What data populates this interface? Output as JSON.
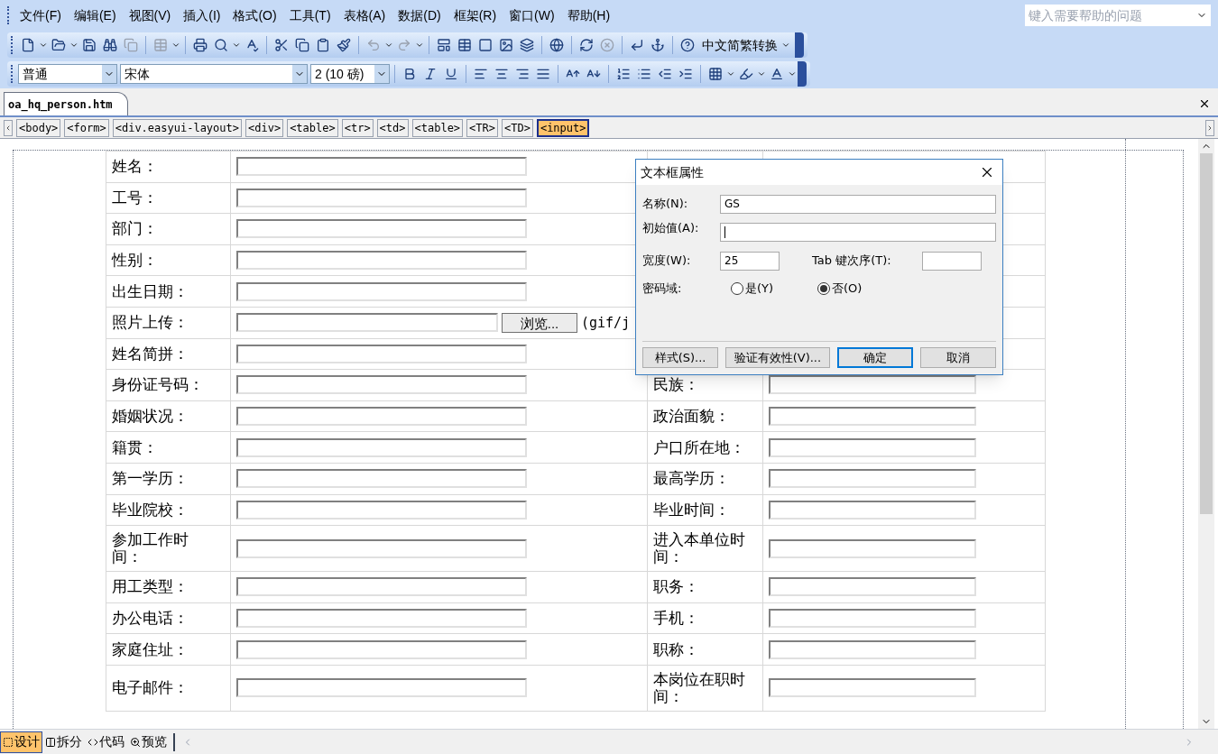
{
  "menu": [
    "文件(F)",
    "编辑(E)",
    "视图(V)",
    "插入(I)",
    "格式(O)",
    "工具(T)",
    "表格(A)",
    "数据(D)",
    "框架(R)",
    "窗口(W)",
    "帮助(H)"
  ],
  "help_search": {
    "placeholder": "键入需要帮助的问题"
  },
  "toolbar": {
    "convert_button": "中文简繁转换",
    "style": "普通",
    "font": "宋体",
    "size": "2 (10 磅)"
  },
  "document_tab": {
    "label": "oa_hq_person.htm"
  },
  "breadcrumb": [
    {
      "label": "<body>",
      "selected": false
    },
    {
      "label": "<form>",
      "selected": false
    },
    {
      "label": "<div.easyui-layout>",
      "selected": false
    },
    {
      "label": "<div>",
      "selected": false
    },
    {
      "label": "<table>",
      "selected": false
    },
    {
      "label": "<tr>",
      "selected": false
    },
    {
      "label": "<td>",
      "selected": false
    },
    {
      "label": "<table>",
      "selected": false
    },
    {
      "label": "<TR>",
      "selected": false
    },
    {
      "label": "<TD>",
      "selected": false
    },
    {
      "label": "<input>",
      "selected": true
    }
  ],
  "form_rows": [
    {
      "kind": "text",
      "label": "姓名："
    },
    {
      "kind": "text",
      "label": "工号："
    },
    {
      "kind": "text",
      "label": "部门："
    },
    {
      "kind": "text",
      "label": "性别："
    },
    {
      "kind": "text",
      "label": "出生日期："
    },
    {
      "kind": "file",
      "label": "照片上传：",
      "browse": "浏览...",
      "note": "(gif/j"
    },
    {
      "kind": "text",
      "label": "姓名简拼："
    },
    {
      "kind": "text",
      "label": "身份证号码：",
      "right_label": "民族："
    },
    {
      "kind": "text",
      "label": "婚姻状况：",
      "right_label": "政治面貌："
    },
    {
      "kind": "text",
      "label": "籍贯：",
      "right_label": "户口所在地："
    },
    {
      "kind": "text",
      "label": "第一学历：",
      "right_label": "最高学历："
    },
    {
      "kind": "text",
      "label": "毕业院校：",
      "right_label": "毕业时间："
    },
    {
      "kind": "text",
      "label": "参加工作时间：",
      "right_label": "进入本单位时间：",
      "tall": true
    },
    {
      "kind": "text",
      "label": "用工类型：",
      "right_label": "职务："
    },
    {
      "kind": "text",
      "label": "办公电话：",
      "right_label": "手机："
    },
    {
      "kind": "text",
      "label": "家庭住址：",
      "right_label": "职称："
    },
    {
      "kind": "text",
      "label": "电子邮件：",
      "right_label": "本岗位在职时间：",
      "tall": true
    }
  ],
  "dialog": {
    "title": "文本框属性",
    "name": {
      "label": "名称(N):",
      "value": "GS"
    },
    "initial_value": {
      "label": "初始值(A):"
    },
    "width": {
      "label": "宽度(W):",
      "value": "25"
    },
    "tab_order": {
      "label": "Tab 键次序(T):"
    },
    "password": {
      "label": "密码域:",
      "options": [
        {
          "label": "是(Y)",
          "selected": false
        },
        {
          "label": "否(O)",
          "selected": true
        }
      ]
    },
    "buttons": [
      {
        "label": "样式(S)...",
        "default": false
      },
      {
        "label": "验证有效性(V)...",
        "default": false
      },
      {
        "label": "确定",
        "default": true
      },
      {
        "label": "取消",
        "default": false
      }
    ]
  },
  "view_tabs": [
    {
      "label": "设计",
      "selected": true
    },
    {
      "label": "拆分",
      "selected": false
    },
    {
      "label": "代码",
      "selected": false
    },
    {
      "label": "预览",
      "selected": false
    }
  ]
}
